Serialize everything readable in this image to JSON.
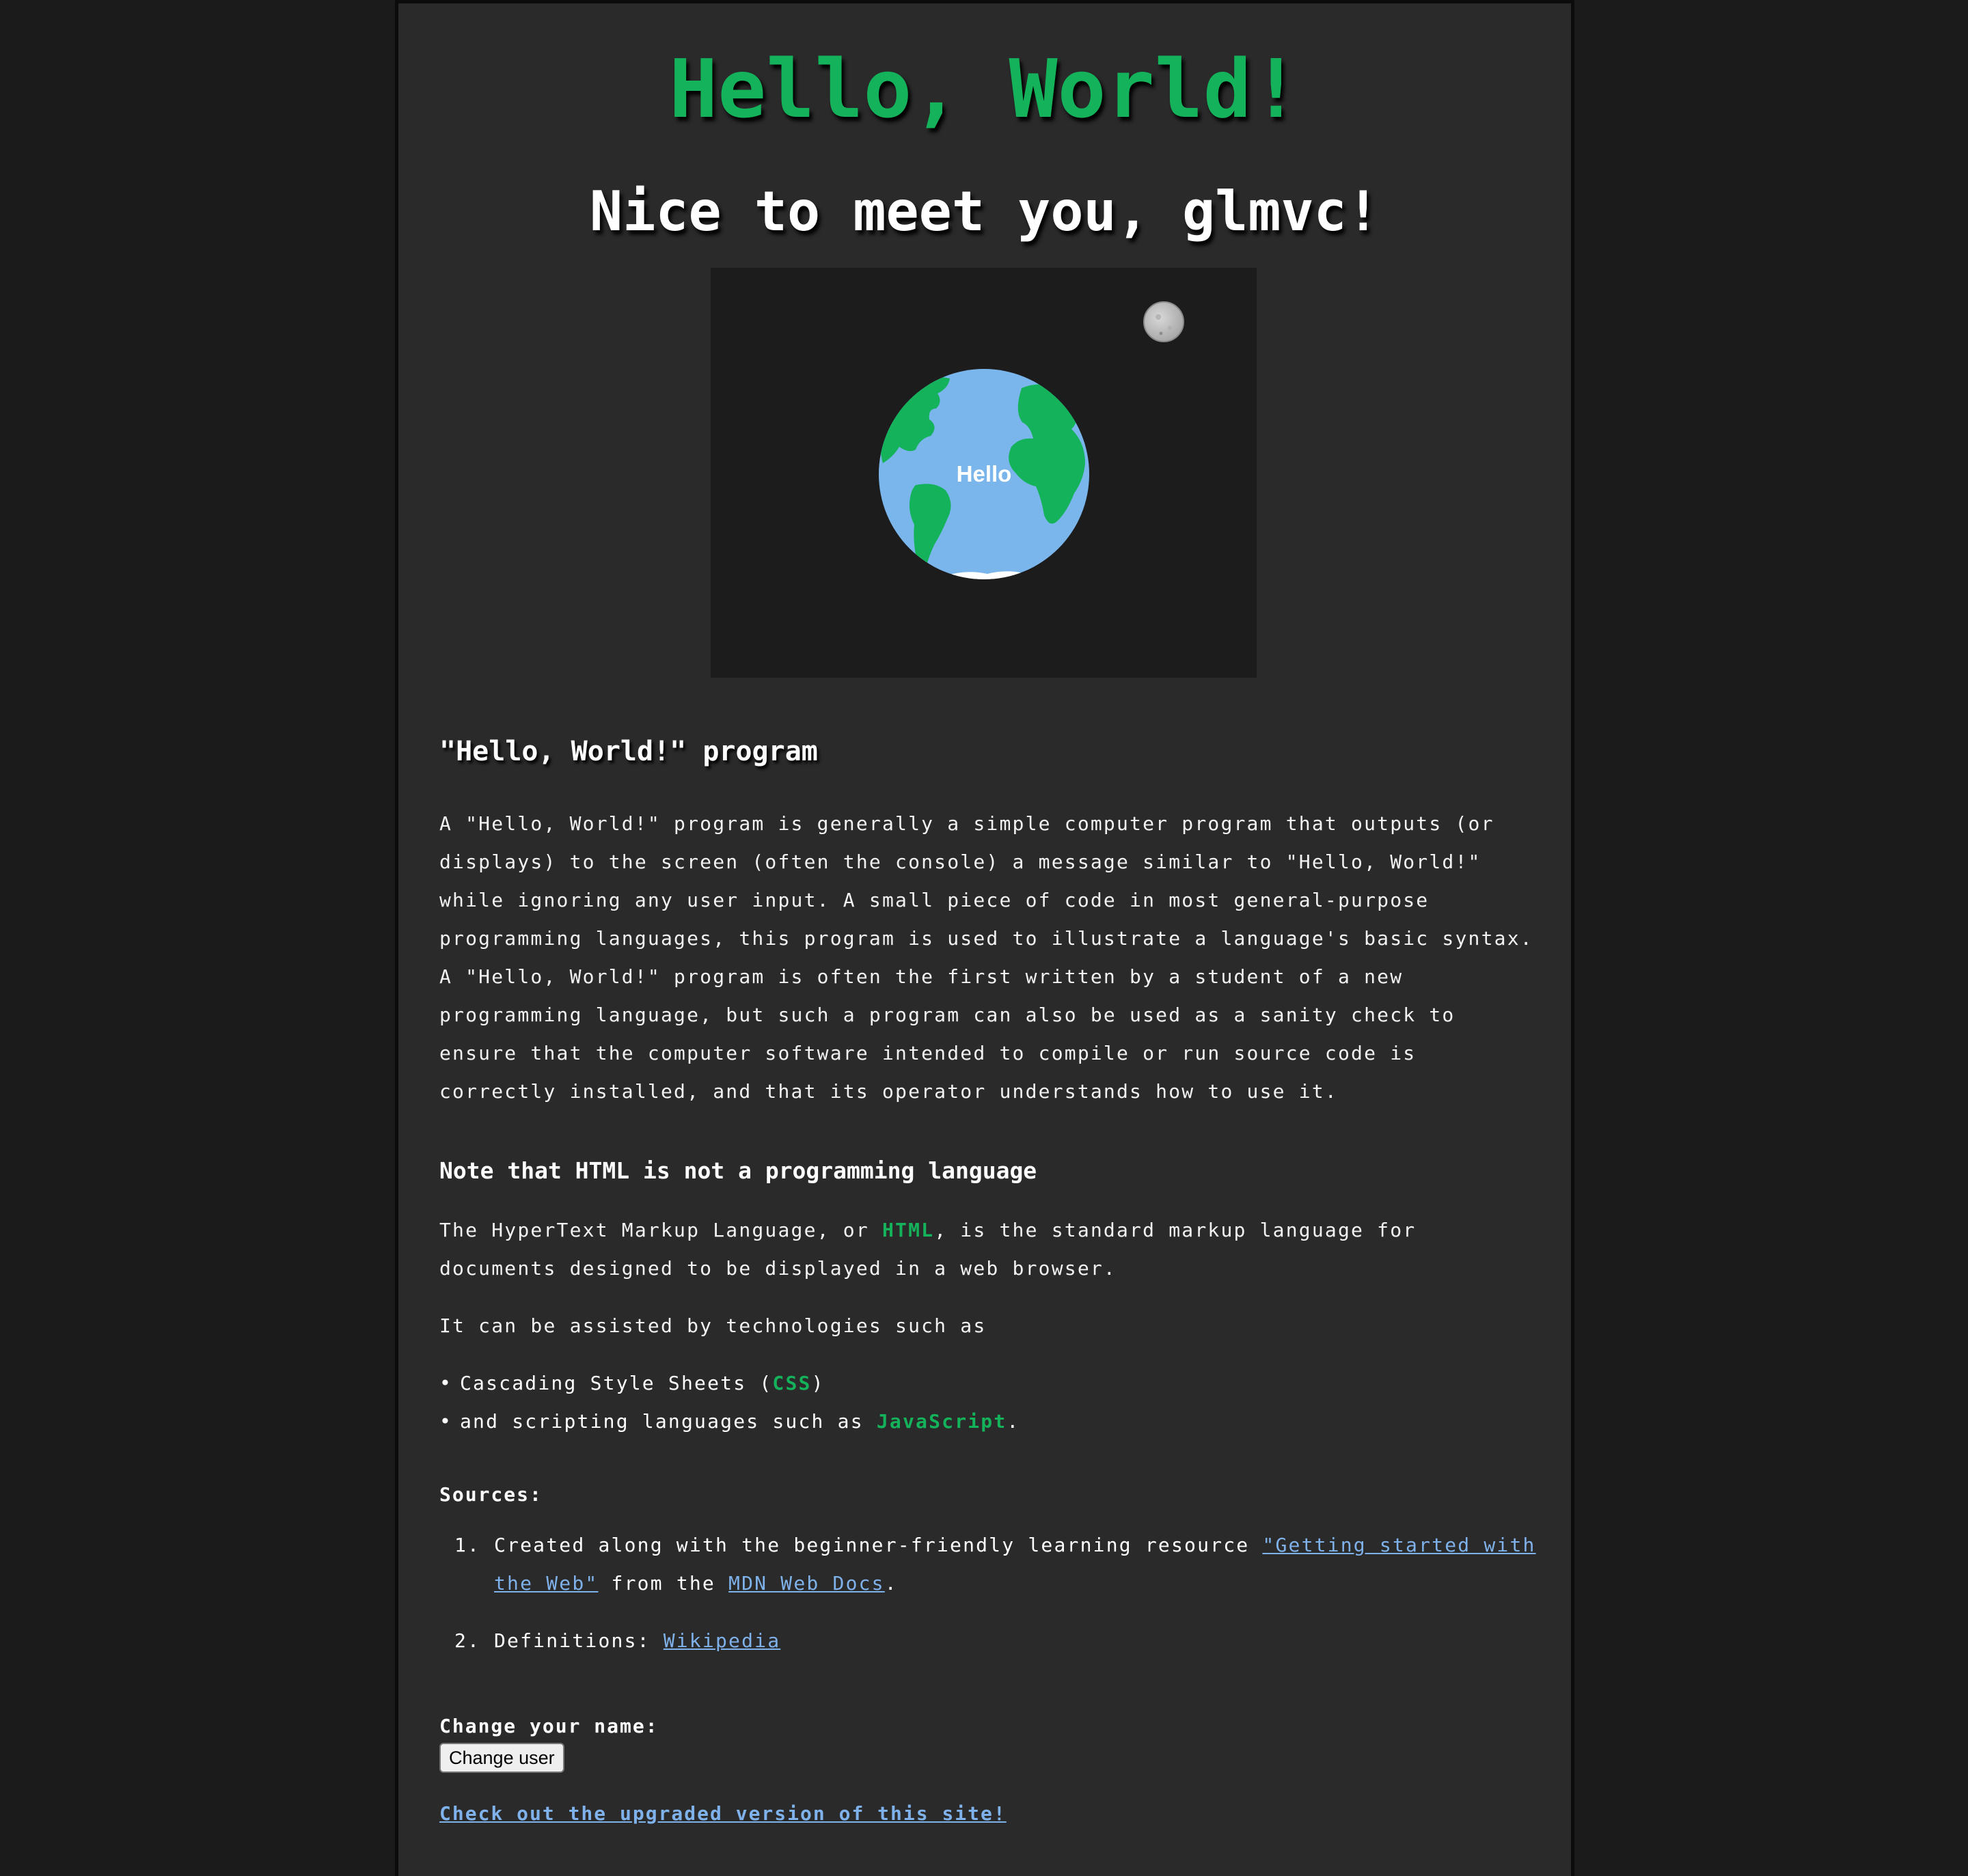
{
  "header": {
    "title": "Hello, World!",
    "greeting": "Nice to meet you, glmvc!"
  },
  "scene": {
    "globe_label": "Hello",
    "globe_icon": "earth-globe",
    "moon_icon": "moon"
  },
  "article": {
    "heading": "\"Hello, World!\" program",
    "paragraph": "A \"Hello, World!\" program is generally a simple computer program that outputs (or displays) to the screen (often the console) a message similar to \"Hello, World!\" while ignoring any user input. A small piece of code in most general-purpose programming languages, this program is used to illustrate a language's basic syntax. A \"Hello, World!\" program is often the first written by a student of a new programming language, but such a program can also be used as a sanity check to ensure that the computer software intended to compile or run source code is correctly installed, and that its operator understands how to use it."
  },
  "note": {
    "heading": "Note that HTML is not a programming language",
    "p1_before": "The HyperText Markup Language, or ",
    "p1_term": "HTML",
    "p1_after": ", is the standard markup language for documents designed to be displayed in a web browser.",
    "p2": "It can be assisted by technologies such as",
    "bullets": [
      {
        "before": "Cascading Style Sheets (",
        "term": "CSS",
        "after": ")"
      },
      {
        "before": "and scripting languages such as ",
        "term": "JavaScript",
        "after": "."
      }
    ]
  },
  "sources": {
    "label": "Sources:",
    "items": [
      {
        "num": "1.",
        "before": "Created along with the beginner-friendly learning resource ",
        "link1": "\"Getting started with the Web\"",
        "middle": " from the ",
        "link2": "MDN Web Docs",
        "after": "."
      },
      {
        "num": "2.",
        "before": "Definitions: ",
        "link1": "Wikipedia"
      }
    ]
  },
  "change_name": {
    "label": "Change your name:",
    "button": "Change user"
  },
  "footer_link": "Check out the upgraded version of this site!",
  "colors": {
    "accent_green": "#14b25a",
    "link_blue": "#7fb1ea",
    "page_bg": "#1b1b1b",
    "panel_bg": "#2a2a2a"
  }
}
